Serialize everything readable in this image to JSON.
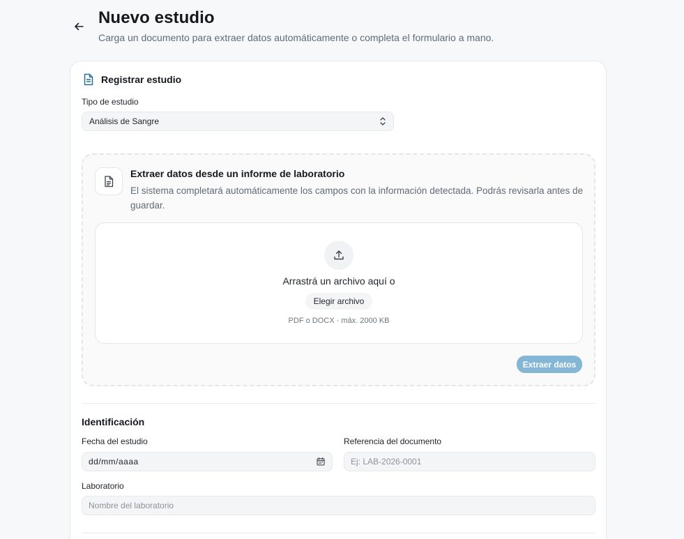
{
  "page": {
    "title": "Nuevo estudio",
    "subtitle": "Carga un documento para extraer datos automáticamente o completa el formulario a mano."
  },
  "card": {
    "title": "Registrar estudio",
    "study_type": {
      "label": "Tipo de estudio",
      "value": "Análisis de Sangre"
    },
    "extract": {
      "title": "Extraer datos desde un informe de laboratorio",
      "description": "El sistema completará automáticamente los campos con la información detectada. Podrás revisarla antes de guardar.",
      "drop_text": "Arrastrá un archivo aquí o",
      "choose_button": "Elegir archivo",
      "file_hint": "PDF o DOCX · máx. 2000 KB",
      "extract_button": "Extraer datos"
    },
    "identification": {
      "section_title": "Identificación",
      "date": {
        "label": "Fecha del estudio",
        "value": "dd/mm/aaaa"
      },
      "reference": {
        "label": "Referencia del documento",
        "placeholder": "Ej: LAB-2026-0001"
      },
      "lab": {
        "label": "Laboratorio",
        "placeholder": "Nombre del laboratorio"
      }
    }
  },
  "colors": {
    "accent_icon": "#2b6f96",
    "extract_button_bg": "#84b7d6",
    "background": "#f7f8fa"
  },
  "icons": {
    "back": "arrow-left-icon",
    "header": "document-icon",
    "extract": "document-text-icon",
    "upload": "upload-icon",
    "select": "chevron-up-down-icon",
    "calendar": "calendar-icon"
  }
}
